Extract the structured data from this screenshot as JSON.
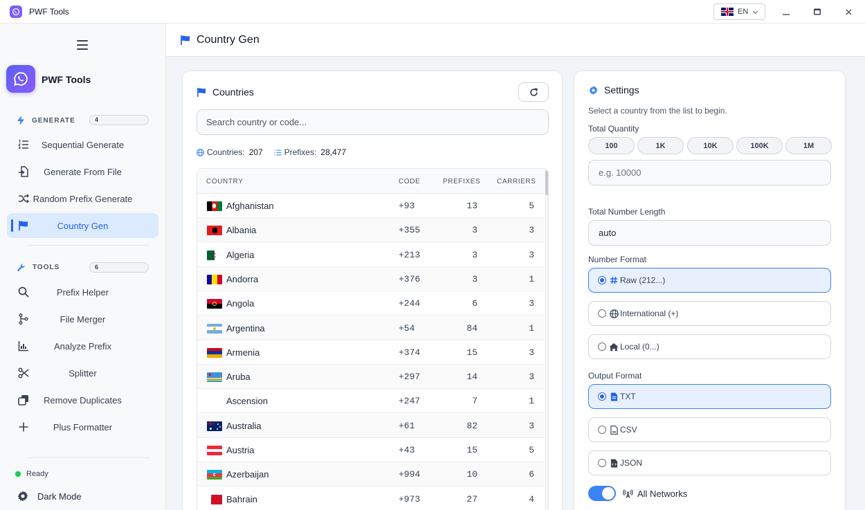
{
  "app": {
    "title": "PWF Tools",
    "language": "EN",
    "accent": "#2563eb",
    "brand_gradient": [
      "#5b5ff5",
      "#8b5cf6"
    ]
  },
  "sidebar": {
    "brand": "PWF Tools",
    "generate": {
      "label": "GENERATE",
      "count": "4",
      "items": [
        {
          "label": "Sequential Generate",
          "icon": "list-ordered-icon"
        },
        {
          "label": "Generate From File",
          "icon": "file-import-icon"
        },
        {
          "label": "Random Prefix Generate",
          "icon": "shuffle-icon"
        },
        {
          "label": "Country Gen",
          "icon": "flag-icon",
          "active": true
        }
      ]
    },
    "tools": {
      "label": "TOOLS",
      "count": "6",
      "items": [
        {
          "label": "Prefix Helper",
          "icon": "search-icon"
        },
        {
          "label": "File Merger",
          "icon": "merge-icon"
        },
        {
          "label": "Analyze Prefix",
          "icon": "bar-chart-icon"
        },
        {
          "label": "Splitter",
          "icon": "scissors-icon"
        },
        {
          "label": "Remove Duplicates",
          "icon": "copy-icon"
        },
        {
          "label": "Plus Formatter",
          "icon": "plus-icon"
        }
      ]
    },
    "status": "Ready",
    "dark_mode": "Dark Mode"
  },
  "header": {
    "title": "Country Gen"
  },
  "countries": {
    "title": "Countries",
    "search_placeholder": "Search country or code...",
    "stats": {
      "countries_label": "Countries:",
      "countries_value": "207",
      "prefixes_label": "Prefixes:",
      "prefixes_value": "28,477"
    },
    "columns": {
      "country": "COUNTRY",
      "code": "CODE",
      "prefixes": "PREFIXES",
      "carriers": "CARRIERS"
    },
    "rows": [
      {
        "name": "Afghanistan",
        "code": "+93",
        "prefixes": "13",
        "carriers": "5"
      },
      {
        "name": "Albania",
        "code": "+355",
        "prefixes": "3",
        "carriers": "3"
      },
      {
        "name": "Algeria",
        "code": "+213",
        "prefixes": "3",
        "carriers": "3"
      },
      {
        "name": "Andorra",
        "code": "+376",
        "prefixes": "3",
        "carriers": "1"
      },
      {
        "name": "Angola",
        "code": "+244",
        "prefixes": "6",
        "carriers": "3"
      },
      {
        "name": "Argentina",
        "code": "+54",
        "prefixes": "84",
        "carriers": "1"
      },
      {
        "name": "Armenia",
        "code": "+374",
        "prefixes": "15",
        "carriers": "3"
      },
      {
        "name": "Aruba",
        "code": "+297",
        "prefixes": "14",
        "carriers": "3"
      },
      {
        "name": "Ascension",
        "code": "+247",
        "prefixes": "7",
        "carriers": "1"
      },
      {
        "name": "Australia",
        "code": "+61",
        "prefixes": "82",
        "carriers": "3"
      },
      {
        "name": "Austria",
        "code": "+43",
        "prefixes": "15",
        "carriers": "5"
      },
      {
        "name": "Azerbaijan",
        "code": "+994",
        "prefixes": "10",
        "carriers": "6"
      },
      {
        "name": "Bahrain",
        "code": "+973",
        "prefixes": "27",
        "carriers": "4"
      }
    ]
  },
  "settings": {
    "title": "Settings",
    "hint": "Select a country from the list to begin.",
    "total_quantity_label": "Total Quantity",
    "quantity_presets": [
      "100",
      "1K",
      "10K",
      "100K",
      "1M"
    ],
    "quantity_placeholder": "e.g. 10000",
    "length_label": "Total Number Length",
    "length_value": "auto",
    "number_format_label": "Number Format",
    "number_formats": [
      {
        "label": "Raw (212...)",
        "icon": "hash-icon",
        "selected": true
      },
      {
        "label": "International (+)",
        "icon": "globe-icon",
        "selected": false
      },
      {
        "label": "Local (0...)",
        "icon": "home-icon",
        "selected": false
      }
    ],
    "output_format_label": "Output Format",
    "output_formats": [
      {
        "label": "TXT",
        "icon": "file-text-icon",
        "selected": true
      },
      {
        "label": "CSV",
        "icon": "file-csv-icon",
        "selected": false
      },
      {
        "label": "JSON",
        "icon": "file-code-icon",
        "selected": false
      }
    ],
    "all_networks_label": "All Networks",
    "all_networks_on": true
  }
}
